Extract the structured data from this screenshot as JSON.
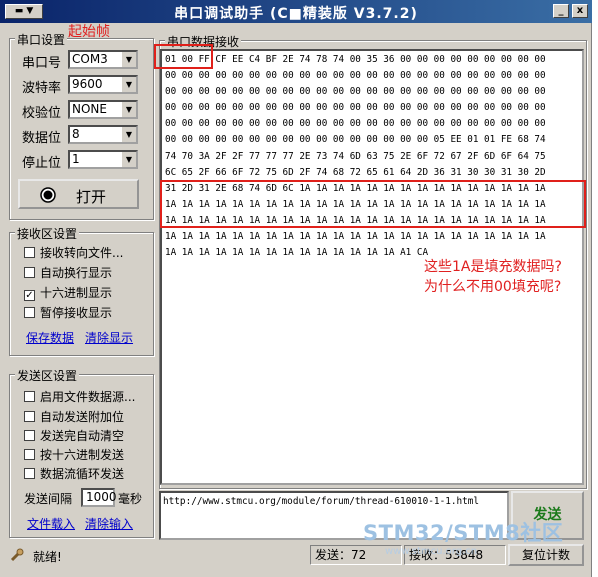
{
  "window": {
    "title": "串口调试助手 (C■精装版 V3.7.2)",
    "sysmenu_icon": "system-menu-icon",
    "minimize_glyph": "_",
    "close_glyph": "x"
  },
  "serial_settings": {
    "legend": "串口设置",
    "port_label": "串口号",
    "port_value": "COM3",
    "baud_label": "波特率",
    "baud_value": "9600",
    "parity_label": "校验位",
    "parity_value": "NONE",
    "databits_label": "数据位",
    "databits_value": "8",
    "stopbits_label": "停止位",
    "stopbits_value": "1",
    "open_button": "打开"
  },
  "receive_settings": {
    "legend": "接收区设置",
    "opt_redirect": "接收转向文件...",
    "opt_autowrap": "自动换行显示",
    "opt_hex": "十六进制显示",
    "opt_pause": "暂停接收显示",
    "hex_checked_mark": "✓",
    "save_link": "保存数据",
    "clear_link": "清除显示"
  },
  "send_settings": {
    "legend": "发送区设置",
    "opt_file_source": "启用文件数据源...",
    "opt_auto_append": "自动发送附加位",
    "opt_auto_clear": "发送完自动清空",
    "opt_hex_send": "按十六进制发送",
    "opt_loop": "数据流循环发送",
    "interval_label": "发送间隔",
    "interval_value": "1000",
    "interval_unit": "毫秒",
    "load_link": "文件载入",
    "clear_input_link": "清除输入"
  },
  "receive_area": {
    "legend": "串口数据接收",
    "lines": [
      "01 00 FF CF EE C4 BF 2E 74 78 74 00 35 36 00 00 00 00 00 00 00 00 00",
      "00 00 00 00 00 00 00 00 00 00 00 00 00 00 00 00 00 00 00 00 00 00 00",
      "00 00 00 00 00 00 00 00 00 00 00 00 00 00 00 00 00 00 00 00 00 00 00",
      "00 00 00 00 00 00 00 00 00 00 00 00 00 00 00 00 00 00 00 00 00 00 00",
      "00 00 00 00 00 00 00 00 00 00 00 00 00 00 00 00 00 00 00 00 00 00 00",
      "00 00 00 00 00 00 00 00 00 00 00 00 00 00 00 00 05 EE 01 01 FE 68 74",
      "74 70 3A 2F 2F 77 77 77 2E 73 74 6D 63 75 2E 6F 72 67 2F 6D 6F 64 75",
      "6C 65 2F 66 6F 72 75 6D 2F 74 68 72 65 61 64 2D 36 31 30 30 31 30 2D",
      "31 2D 31 2E 68 74 6D 6C 1A 1A 1A 1A 1A 1A 1A 1A 1A 1A 1A 1A 1A 1A 1A",
      "1A 1A 1A 1A 1A 1A 1A 1A 1A 1A 1A 1A 1A 1A 1A 1A 1A 1A 1A 1A 1A 1A 1A",
      "1A 1A 1A 1A 1A 1A 1A 1A 1A 1A 1A 1A 1A 1A 1A 1A 1A 1A 1A 1A 1A 1A 1A",
      "1A 1A 1A 1A 1A 1A 1A 1A 1A 1A 1A 1A 1A 1A 1A 1A 1A 1A 1A 1A 1A 1A 1A",
      "1A 1A 1A 1A 1A 1A 1A 1A 1A 1A 1A 1A 1A 1A A1 CA"
    ]
  },
  "annotations": {
    "start_frame": "起始帧",
    "question_line1": "这些1A是填充数据吗?",
    "question_line2": "为什么不用00填充呢?"
  },
  "send_area": {
    "input_value": "http://www.stmcu.org/module/forum/thread-610010-1-1.html",
    "send_button": "发送"
  },
  "statusbar": {
    "ready_text": "就绪!",
    "send_count": "发送：72",
    "recv_count": "接收：53848",
    "reset_button": "复位计数"
  },
  "watermark": {
    "text": "STM32/STM8社区",
    "url": "www.stmcu.org.cn"
  }
}
